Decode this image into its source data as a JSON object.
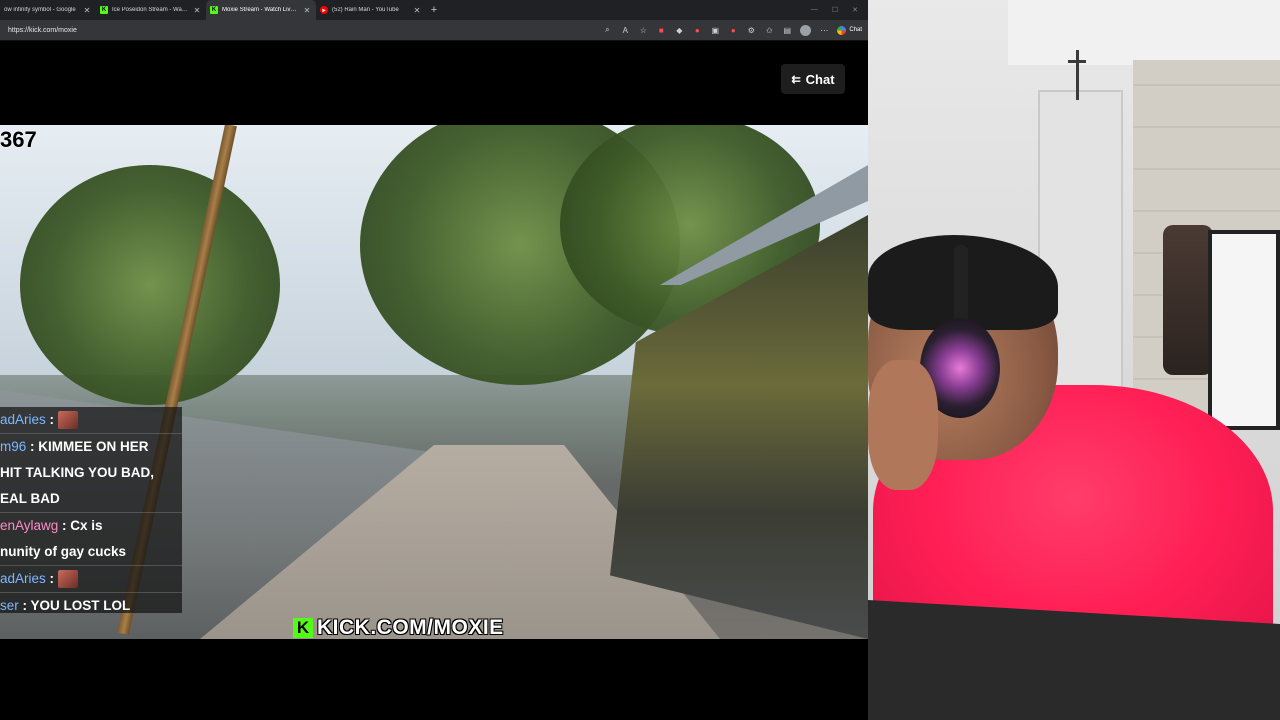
{
  "browser": {
    "tabs": [
      {
        "title": "ow infinity symbol - Google",
        "favicon": "google-icon",
        "active": false
      },
      {
        "title": "Ice Poseidon Stream - Watch Live",
        "favicon": "kick-icon",
        "active": false
      },
      {
        "title": "Moxie Stream - Watch Live o",
        "favicon": "kick-icon",
        "active": true
      },
      {
        "title": "(52) Rain Man - YouTube",
        "favicon": "youtube-icon",
        "active": false
      }
    ],
    "new_tab_label": "+",
    "url": "https://kick.com/moxie",
    "chat_extension_label": "Chat"
  },
  "page": {
    "chat_toggle_label": "Chat",
    "viewer_count": "367",
    "watermark_logo": "K",
    "watermark_text": "KICK.COM/MOXIE"
  },
  "chat_overlay": {
    "messages": [
      {
        "user": "adAries",
        "sep": " : ",
        "text": "",
        "emote": true
      },
      {
        "user": "m96",
        "sep": " : ",
        "text": "KIMMEE ON HER",
        "emote": false
      },
      {
        "user": "",
        "sep": "",
        "text": "HIT TALKING YOU BAD,",
        "emote": false
      },
      {
        "user": "",
        "sep": "",
        "text": "EAL BAD",
        "emote": false
      },
      {
        "user": "enAylawg",
        "sep": " : ",
        "text": "Cx is",
        "emote": false
      },
      {
        "user": "",
        "sep": "",
        "text": "nunity of gay cucks",
        "emote": false
      },
      {
        "user": "adAries",
        "sep": " : ",
        "text": "",
        "emote": true
      },
      {
        "user": "ser",
        "sep": " : ",
        "text": "YOU LOST LOL",
        "emote": false
      }
    ]
  },
  "colors": {
    "kick_green": "#53fc18",
    "shirt_pink": "#ff1f55"
  }
}
